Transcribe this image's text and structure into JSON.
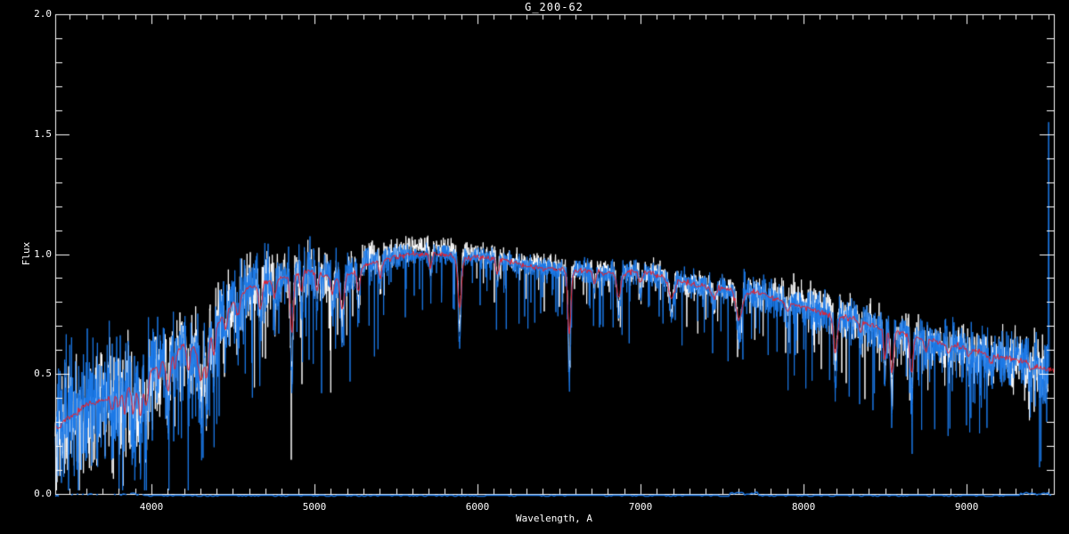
{
  "window": {
    "kind": "spectral plot viewer",
    "background": "#000000"
  },
  "chart_data": {
    "type": "line",
    "title": "G_200-62",
    "xlabel": "Wavelength, A",
    "ylabel": "Flux",
    "xlim": [
      3410,
      9535
    ],
    "ylim": [
      0.0,
      2.0
    ],
    "grid": false,
    "legend": "none",
    "x_major_ticks": [
      4000,
      5000,
      6000,
      7000,
      8000,
      9000
    ],
    "x_tick_labels": [
      "4000",
      "5000",
      "6000",
      "7000",
      "8000",
      "9000"
    ],
    "x_minor_step": 100,
    "y_major_ticks": [
      0.0,
      0.5,
      1.0,
      1.5,
      2.0
    ],
    "y_tick_labels": [
      "0.0",
      "0.5",
      "1.0",
      "1.5",
      "2.0"
    ],
    "y_minor_step": 0.1,
    "colors": {
      "background": "#000000",
      "axis": "#ffffff",
      "observed_white": "#ffffff",
      "observed_blue": "#1b79e8",
      "model_red": "#e8202d"
    },
    "series": [
      {
        "name": "observed-spectrum-white",
        "color": "#ffffff",
        "style": "noisy"
      },
      {
        "name": "observed-spectrum-blue",
        "color": "#1b79e8",
        "style": "noisy"
      },
      {
        "name": "model-template-red",
        "color": "#e8202d",
        "style": "smooth"
      },
      {
        "name": "sky-zero-level-blue",
        "color": "#1b79e8",
        "style": "baseline"
      }
    ],
    "continuum": [
      [
        3410,
        0.27
      ],
      [
        3500,
        0.32
      ],
      [
        3600,
        0.37
      ],
      [
        3700,
        0.39
      ],
      [
        3800,
        0.43
      ],
      [
        3900,
        0.44
      ],
      [
        4000,
        0.52
      ],
      [
        4100,
        0.56
      ],
      [
        4200,
        0.62
      ],
      [
        4300,
        0.6
      ],
      [
        4400,
        0.7
      ],
      [
        4500,
        0.8
      ],
      [
        4600,
        0.86
      ],
      [
        4700,
        0.88
      ],
      [
        4800,
        0.9
      ],
      [
        4900,
        0.92
      ],
      [
        5000,
        0.93
      ],
      [
        5100,
        0.9
      ],
      [
        5200,
        0.91
      ],
      [
        5300,
        0.95
      ],
      [
        5400,
        0.97
      ],
      [
        5500,
        0.99
      ],
      [
        5600,
        1.0
      ],
      [
        5700,
        1.0
      ],
      [
        5800,
        1.0
      ],
      [
        5900,
        0.98
      ],
      [
        6000,
        0.99
      ],
      [
        6100,
        0.98
      ],
      [
        6200,
        0.97
      ],
      [
        6300,
        0.95
      ],
      [
        6400,
        0.94
      ],
      [
        6500,
        0.94
      ],
      [
        6600,
        0.93
      ],
      [
        6700,
        0.93
      ],
      [
        6800,
        0.92
      ],
      [
        6900,
        0.92
      ],
      [
        7000,
        0.93
      ],
      [
        7100,
        0.91
      ],
      [
        7200,
        0.89
      ],
      [
        7300,
        0.88
      ],
      [
        7400,
        0.86
      ],
      [
        7500,
        0.86
      ],
      [
        7600,
        0.84
      ],
      [
        7700,
        0.84
      ],
      [
        7800,
        0.82
      ],
      [
        7900,
        0.8
      ],
      [
        8000,
        0.78
      ],
      [
        8100,
        0.76
      ],
      [
        8200,
        0.74
      ],
      [
        8300,
        0.73
      ],
      [
        8400,
        0.71
      ],
      [
        8500,
        0.69
      ],
      [
        8600,
        0.67
      ],
      [
        8700,
        0.65
      ],
      [
        8800,
        0.64
      ],
      [
        8900,
        0.62
      ],
      [
        9000,
        0.61
      ],
      [
        9100,
        0.59
      ],
      [
        9200,
        0.57
      ],
      [
        9300,
        0.56
      ],
      [
        9400,
        0.54
      ],
      [
        9480,
        0.52
      ],
      [
        9535,
        0.52
      ]
    ],
    "absorption_lines": [
      [
        3760,
        0.3,
        7
      ],
      [
        3798,
        0.32,
        6
      ],
      [
        3835,
        0.38,
        6
      ],
      [
        3889,
        0.42,
        7
      ],
      [
        3933,
        0.52,
        8
      ],
      [
        3969,
        0.48,
        8
      ],
      [
        4045,
        0.18,
        5
      ],
      [
        4101,
        0.42,
        8
      ],
      [
        4144,
        0.2,
        5
      ],
      [
        4227,
        0.3,
        6
      ],
      [
        4305,
        0.4,
        11
      ],
      [
        4340,
        0.42,
        7
      ],
      [
        4383,
        0.28,
        6
      ],
      [
        4455,
        0.18,
        6
      ],
      [
        4531,
        0.18,
        7
      ],
      [
        4668,
        0.22,
        7
      ],
      [
        4755,
        0.15,
        6
      ],
      [
        4861,
        0.48,
        7
      ],
      [
        4920,
        0.16,
        6
      ],
      [
        5015,
        0.16,
        6
      ],
      [
        5110,
        0.14,
        6
      ],
      [
        5170,
        0.28,
        9
      ],
      [
        5270,
        0.18,
        7
      ],
      [
        5405,
        0.12,
        6
      ],
      [
        5712,
        0.1,
        6
      ],
      [
        5890,
        0.38,
        8
      ],
      [
        6122,
        0.12,
        6
      ],
      [
        6563,
        0.52,
        7
      ],
      [
        6717,
        0.1,
        6
      ],
      [
        6867,
        0.2,
        9
      ],
      [
        7000,
        0.1,
        8
      ],
      [
        7190,
        0.16,
        11
      ],
      [
        7450,
        0.1,
        9
      ],
      [
        7605,
        0.24,
        13
      ],
      [
        7900,
        0.08,
        8
      ],
      [
        8195,
        0.38,
        8
      ],
      [
        8350,
        0.1,
        7
      ],
      [
        8498,
        0.34,
        6
      ],
      [
        8542,
        0.48,
        7
      ],
      [
        8662,
        0.44,
        7
      ],
      [
        8750,
        0.12,
        7
      ],
      [
        8890,
        0.1,
        7
      ],
      [
        9015,
        0.1,
        7
      ],
      [
        9150,
        0.1,
        9
      ],
      [
        9400,
        0.1,
        8
      ]
    ],
    "noise_amplitude": [
      [
        3410,
        0.13
      ],
      [
        3700,
        0.13
      ],
      [
        3950,
        0.11
      ],
      [
        4200,
        0.09
      ],
      [
        4500,
        0.075
      ],
      [
        4800,
        0.06
      ],
      [
        5100,
        0.05
      ],
      [
        5350,
        0.035
      ],
      [
        5600,
        0.022
      ],
      [
        6000,
        0.02
      ],
      [
        6500,
        0.022
      ],
      [
        7000,
        0.026
      ],
      [
        7400,
        0.028
      ],
      [
        7800,
        0.032
      ],
      [
        8300,
        0.042
      ],
      [
        8800,
        0.048
      ],
      [
        9200,
        0.055
      ],
      [
        9500,
        0.07
      ]
    ],
    "white_offset": [
      [
        3410,
        -0.015
      ],
      [
        5200,
        0.0
      ],
      [
        5450,
        0.025
      ],
      [
        5800,
        0.03
      ],
      [
        6200,
        0.01
      ],
      [
        6900,
        0.0
      ],
      [
        7750,
        0.0
      ],
      [
        7900,
        0.03
      ],
      [
        8150,
        0.028
      ],
      [
        8350,
        0.0
      ],
      [
        9500,
        0.0
      ]
    ],
    "blue_offset": [
      [
        3410,
        0.015
      ],
      [
        4800,
        0.008
      ],
      [
        5300,
        0.0
      ],
      [
        9500,
        0.0
      ]
    ],
    "sky_line": {
      "flux_level": 0.005,
      "dash_region": [
        3440,
        3950
      ],
      "bumps": [
        [
          7550,
          7720
        ],
        [
          9330,
          9515
        ]
      ]
    },
    "edge_spike": {
      "wavelength": 9503,
      "peak_flux": 1.55
    },
    "data_end_wavelength": 9500
  }
}
